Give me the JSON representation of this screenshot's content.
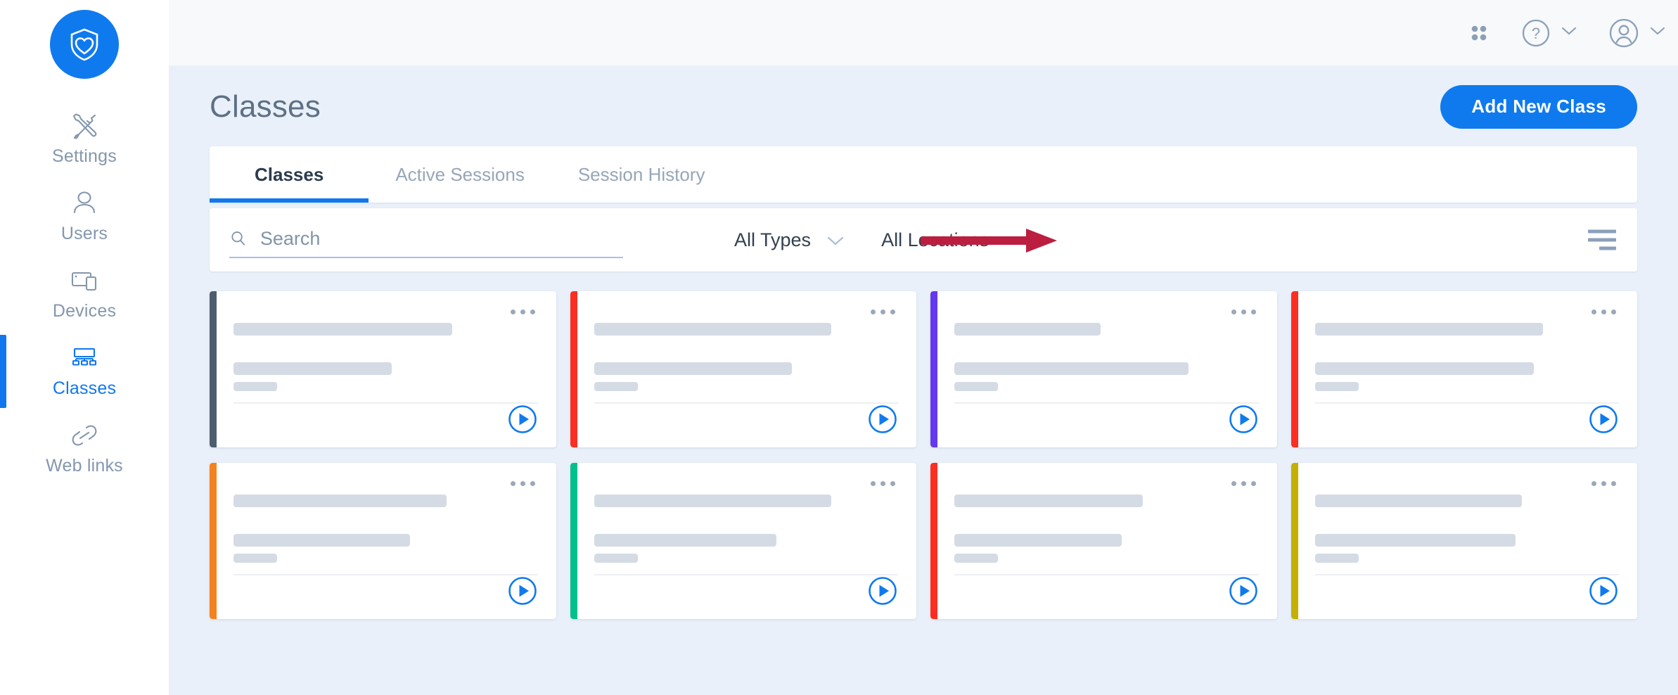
{
  "brand": {
    "logo_icon": "shield-heart-logo"
  },
  "sidebar": {
    "items": [
      {
        "label": "Settings",
        "icon": "tools-icon",
        "active": false
      },
      {
        "label": "Users",
        "icon": "user-icon",
        "active": false
      },
      {
        "label": "Devices",
        "icon": "devices-icon",
        "active": false
      },
      {
        "label": "Classes",
        "icon": "classroom-icon",
        "active": true
      },
      {
        "label": "Web links",
        "icon": "link-icon",
        "active": false
      }
    ]
  },
  "topbar": {
    "apps_icon": "grid-apps-icon",
    "help_icon": "question-circle-icon",
    "help_chevron_icon": "chevron-down-icon",
    "account_icon": "user-circle-icon",
    "account_chevron_icon": "chevron-down-icon"
  },
  "page": {
    "title": "Classes",
    "add_button_label": "Add New Class"
  },
  "tabs": [
    {
      "label": "Classes",
      "active": true
    },
    {
      "label": "Active Sessions",
      "active": false
    },
    {
      "label": "Session History",
      "active": false
    }
  ],
  "filters": {
    "search_placeholder": "Search",
    "search_value": "",
    "search_icon": "search-icon",
    "type_select": "All Types",
    "location_select": "All Locations",
    "chevron_icon": "chevron-down-icon",
    "list_view_toggle_icon": "list-view-icon"
  },
  "annotation": {
    "arrow_color": "#bc1e40",
    "points_to": "list-view-icon"
  },
  "colors": {
    "accent_blue": "#0f7aee",
    "page_bg": "#e9f0f9",
    "topbar_bg": "#f7f9fb",
    "skeleton": "#d4dbe4"
  },
  "cards": [
    {
      "accent": "#4e5d6e",
      "menu_icon": "more-options-icon",
      "play_icon": "play-circle-icon"
    },
    {
      "accent": "#fb2e21",
      "menu_icon": "more-options-icon",
      "play_icon": "play-circle-icon"
    },
    {
      "accent": "#6438f0",
      "menu_icon": "more-options-icon",
      "play_icon": "play-circle-icon"
    },
    {
      "accent": "#fb2e21",
      "menu_icon": "more-options-icon",
      "play_icon": "play-circle-icon"
    },
    {
      "accent": "#f58220",
      "menu_icon": "more-options-icon",
      "play_icon": "play-circle-icon"
    },
    {
      "accent": "#00c08b",
      "menu_icon": "more-options-icon",
      "play_icon": "play-circle-icon"
    },
    {
      "accent": "#fb2e21",
      "menu_icon": "more-options-icon",
      "play_icon": "play-circle-icon"
    },
    {
      "accent": "#c4b000",
      "menu_icon": "more-options-icon",
      "play_icon": "play-circle-icon"
    }
  ]
}
